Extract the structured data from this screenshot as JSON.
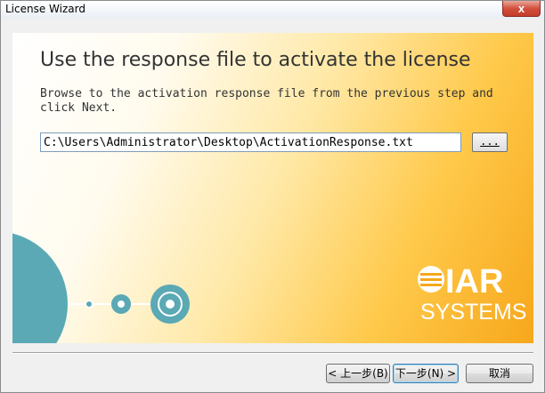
{
  "window": {
    "title": "License Wizard",
    "close_label": "x"
  },
  "page": {
    "heading": "Use the response file to activate the license",
    "instructions": "Browse to the activation response file from the previous step and click Next.",
    "file_path": "C:\\Users\\Administrator\\Desktop\\ActivationResponse.txt",
    "browse_label": "..."
  },
  "logo": {
    "brand": "IAR",
    "sub": "SYSTEMS"
  },
  "buttons": {
    "back": "< 上一步(B)",
    "next": "下一步(N) >",
    "cancel": "取消"
  },
  "colors": {
    "accent_teal": "#5aa9b5",
    "panel_orange": "#f7a71b"
  }
}
